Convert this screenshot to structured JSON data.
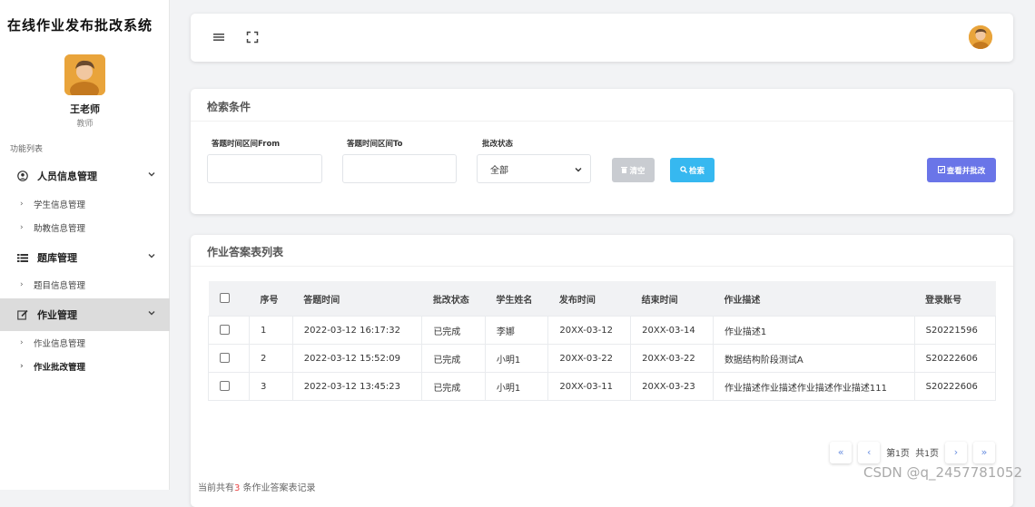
{
  "app": {
    "title": "在线作业发布批改系统"
  },
  "user": {
    "name": "王老师",
    "role": "教师"
  },
  "sidebar": {
    "caption": "功能列表",
    "groups": [
      {
        "label": "人员信息管理",
        "icon": "user-circle-icon",
        "items": [
          "学生信息管理",
          "助教信息管理"
        ]
      },
      {
        "label": "题库管理",
        "icon": "list-icon",
        "items": [
          "题目信息管理"
        ]
      },
      {
        "label": "作业管理",
        "icon": "edit-icon",
        "items": [
          "作业信息管理",
          "作业批改管理"
        ]
      }
    ],
    "active_group": "作业管理",
    "current_item": "作业批改管理"
  },
  "topbar": {
    "menu_icon": "hamburger-icon",
    "fullscreen_icon": "fullscreen-icon"
  },
  "search": {
    "title": "检索条件",
    "from_label": "答题时间区间From",
    "to_label": "答题时间区间To",
    "status_label": "批改状态",
    "status_value": "全部",
    "clear_label": "清空",
    "search_label": "检索",
    "review_label": "查看并批改"
  },
  "list": {
    "title": "作业答案表列表",
    "columns": [
      "序号",
      "答题时间",
      "批改状态",
      "学生姓名",
      "发布时间",
      "结束时间",
      "作业描述",
      "登录账号"
    ],
    "rows": [
      [
        "1",
        "2022-03-12 16:17:32",
        "已完成",
        "李娜",
        "20XX-03-12",
        "20XX-03-14",
        "作业描述1",
        "S20221596"
      ],
      [
        "2",
        "2022-03-12 15:52:09",
        "已完成",
        "小明1",
        "20XX-03-22",
        "20XX-03-22",
        "数据结构阶段测试A",
        "S20222606"
      ],
      [
        "3",
        "2022-03-12 13:45:23",
        "已完成",
        "小明1",
        "20XX-03-11",
        "20XX-03-23",
        "作业描述作业描述作业描述作业描述111",
        "S20222606"
      ]
    ]
  },
  "pager": {
    "first": "«",
    "prev": "‹",
    "page_prefix": "第",
    "page_num": "1",
    "page_suffix": "页",
    "total_prefix": "共",
    "total_num": "1",
    "total_suffix": "页",
    "next": "›",
    "last": "»"
  },
  "footer": {
    "prefix": "当前共有",
    "count": "3",
    "suffix": " 条作业答案表记录"
  },
  "watermark": "CSDN @q_2457781052",
  "colors": {
    "search_button": "#36b8f0",
    "review_button": "#6a75e8",
    "clear_button": "#c9ccd1",
    "active_menu": "#dcdcdc"
  }
}
